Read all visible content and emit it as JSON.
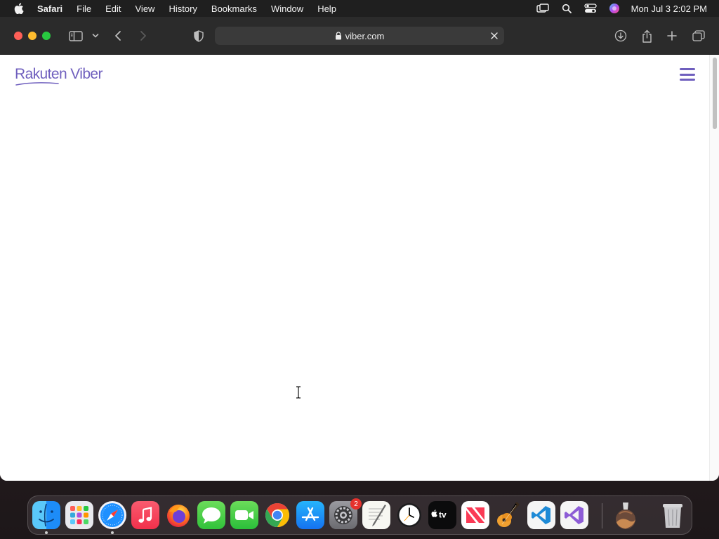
{
  "menubar": {
    "app_name": "Safari",
    "items": [
      "File",
      "Edit",
      "View",
      "History",
      "Bookmarks",
      "Window",
      "Help"
    ],
    "clock": "Mon Jul 3  2:02 PM",
    "status_icons": [
      "screen-mirroring-icon",
      "spotlight-search-icon",
      "control-center-icon",
      "siri-icon"
    ]
  },
  "toolbar": {
    "url": "viber.com",
    "icons": [
      "sidebar-icon",
      "chevron-down-icon",
      "back-icon",
      "forward-icon",
      "privacy-shield-icon",
      "download-icon",
      "share-icon",
      "new-tab-icon",
      "tab-overview-icon"
    ]
  },
  "page": {
    "logo_text": "Rakuten Viber",
    "brand_color": "#6f5fbe"
  },
  "dock": {
    "apps": [
      "Finder",
      "Launchpad",
      "Safari",
      "Music",
      "Firefox",
      "Messages",
      "FaceTime",
      "Google Chrome",
      "App Store",
      "System Settings",
      "TextEdit",
      "Clock",
      "Apple TV",
      "News",
      "GarageBand",
      "Visual Studio Code",
      "Visual Studio",
      "Downloads",
      "Trash"
    ],
    "settings_badge": "2"
  }
}
